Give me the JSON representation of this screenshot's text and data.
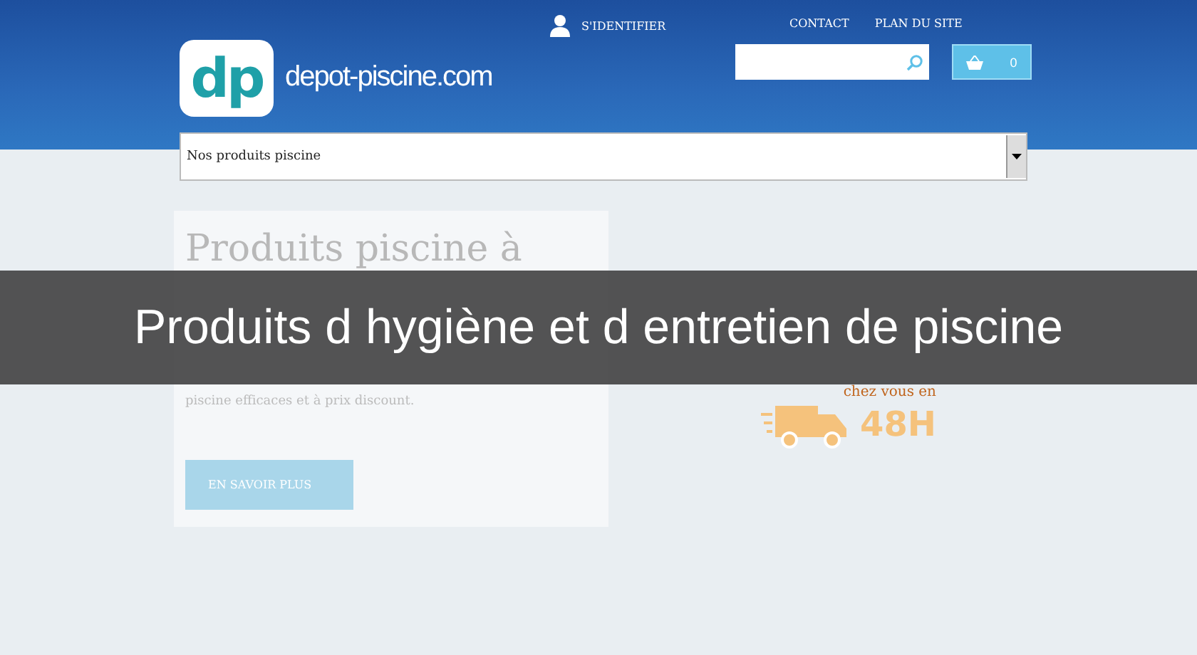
{
  "header": {
    "logo_mark": "dp",
    "logo_text": "depot-piscine.com",
    "login": "S'IDENTIFIER",
    "links": [
      "CONTACT",
      "PLAN DU SITE"
    ],
    "cart_count": "0"
  },
  "menu": {
    "value": "Nos produits piscine"
  },
  "hero": {
    "title": "Produits piscine à",
    "text": "piscine efficaces et à prix discount.",
    "button": "EN SAVOIR PLUS"
  },
  "promo": {
    "line": "chez vous en",
    "delay": "48H"
  },
  "overlay": {
    "title": "Produits d hygiène et d entretien de piscine"
  }
}
